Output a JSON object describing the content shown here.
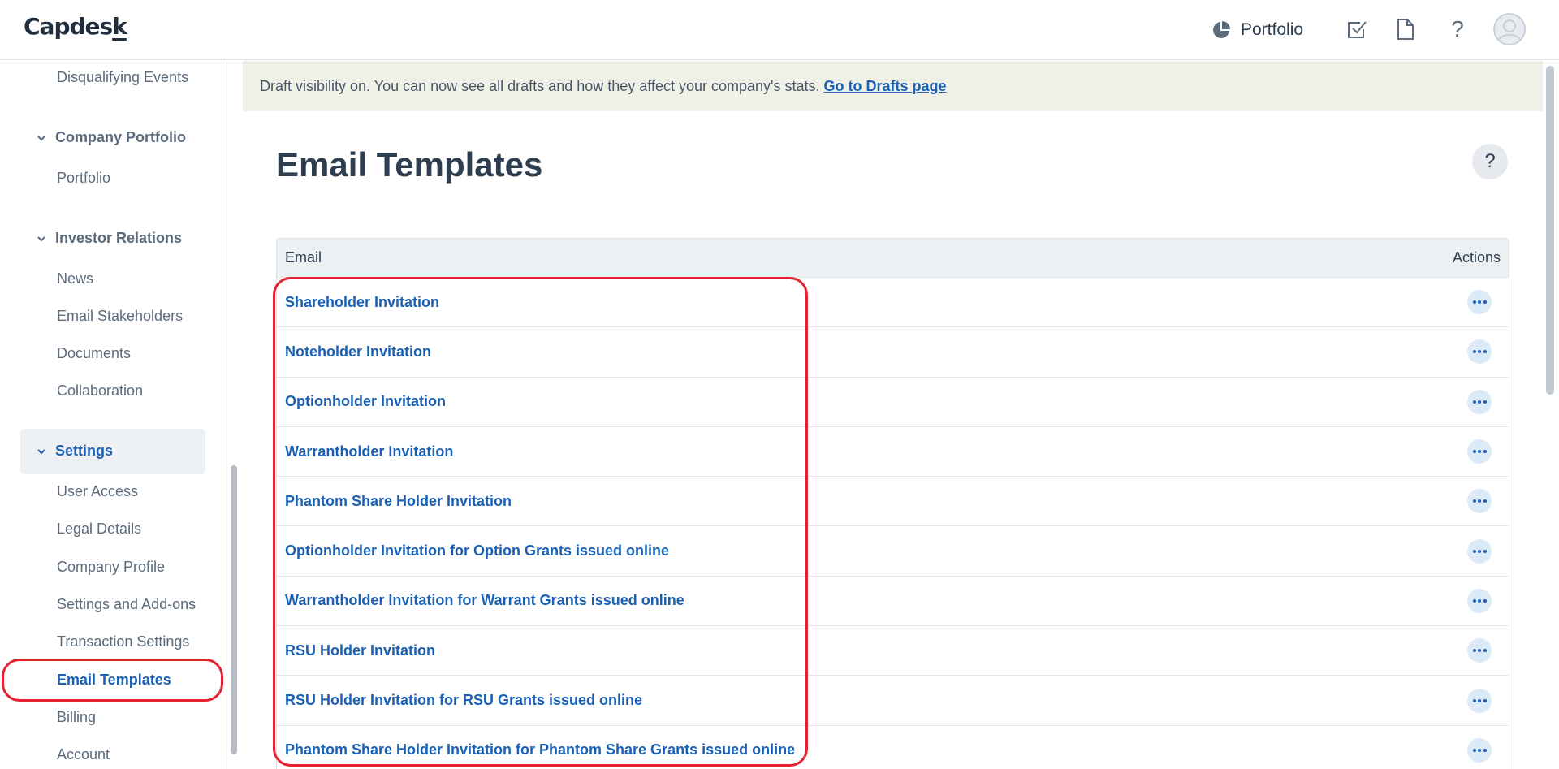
{
  "app": {
    "logo_main": "Capdes",
    "logo_tail": "k"
  },
  "topbar": {
    "portfolio_label": "Portfolio",
    "icons": [
      "pie-chart-icon",
      "checkbox-icon",
      "document-icon",
      "help-icon",
      "avatar-icon"
    ]
  },
  "sidebar": {
    "top_item": "Disqualifying Events",
    "sections": [
      {
        "label": "Company Portfolio",
        "items": [
          "Portfolio"
        ]
      },
      {
        "label": "Investor Relations",
        "items": [
          "News",
          "Email Stakeholders",
          "Documents",
          "Collaboration"
        ]
      },
      {
        "label": "Settings",
        "items": [
          "User Access",
          "Legal Details",
          "Company Profile",
          "Settings and Add-ons",
          "Transaction Settings",
          "Email Templates",
          "Billing",
          "Account"
        ]
      }
    ],
    "active_section": "Settings",
    "current_item": "Email Templates"
  },
  "banner": {
    "text": "Draft visibility on. You can now see all drafts and how they affect your company's stats.",
    "link": "Go to Drafts page"
  },
  "main": {
    "title": "Email Templates",
    "help_label": "?"
  },
  "table": {
    "col_email": "Email",
    "col_actions": "Actions",
    "rows": [
      "Shareholder Invitation",
      "Noteholder Invitation",
      "Optionholder Invitation",
      "Warrantholder Invitation",
      "Phantom Share Holder Invitation",
      "Optionholder Invitation for Option Grants issued online",
      "Warrantholder Invitation for Warrant Grants issued online",
      "RSU Holder Invitation",
      "RSU Holder Invitation for RSU Grants issued online",
      "Phantom Share Holder Invitation for Phantom Share Grants issued online"
    ]
  },
  "colors": {
    "brand_blue": "#1a61b5",
    "highlight_red": "#e52232",
    "banner_bg": "#f0f1e6"
  }
}
